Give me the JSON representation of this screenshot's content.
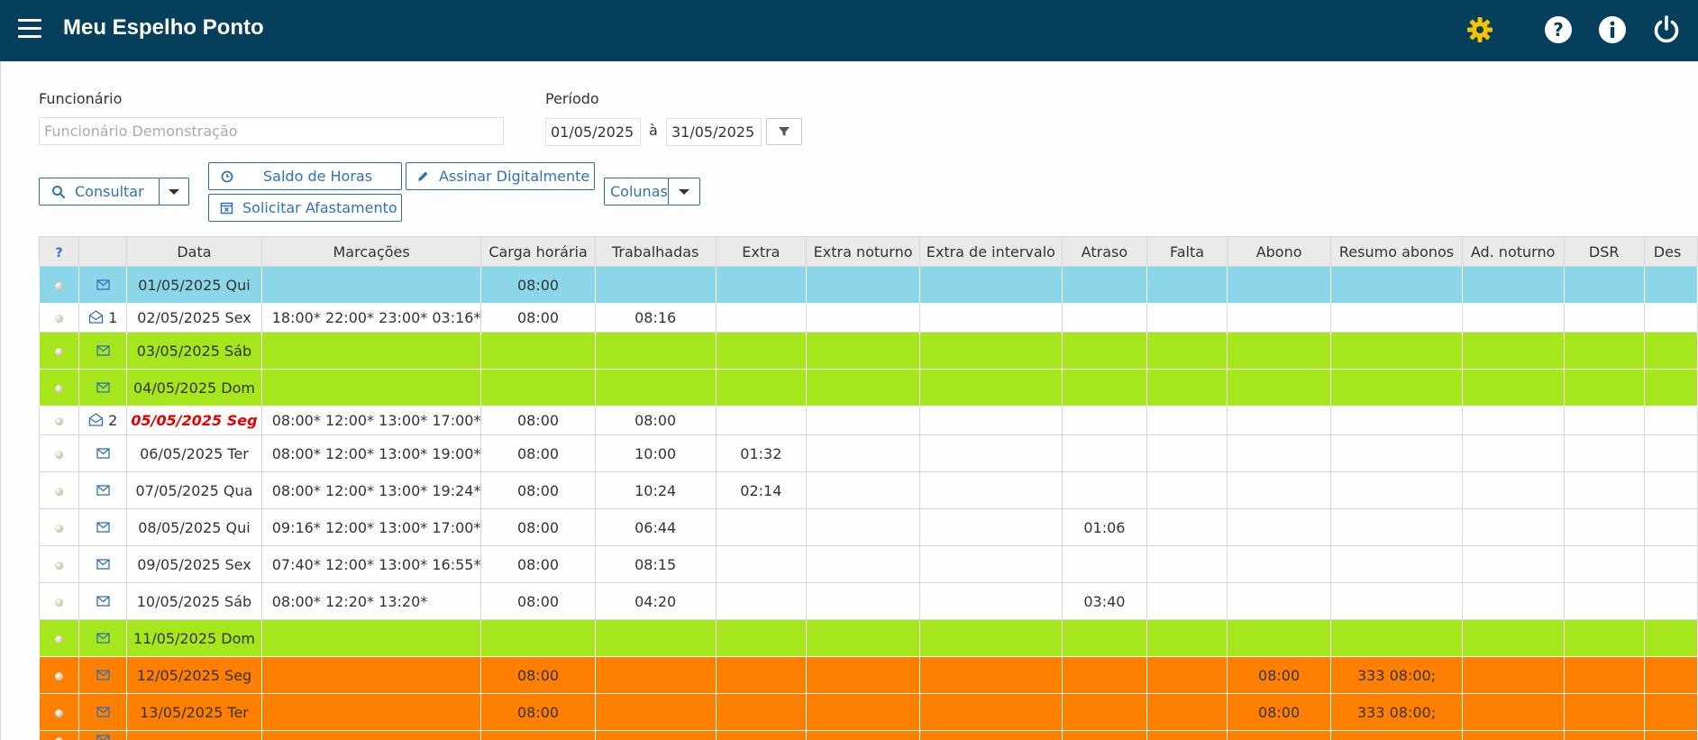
{
  "header": {
    "title": "Meu Espelho Ponto",
    "icons": [
      "menu-icon",
      "gear-icon",
      "help-icon",
      "info-icon",
      "power-icon"
    ],
    "colors": {
      "bar": "#053f5c",
      "gear": "#f5c400",
      "icon": "#ffffff"
    }
  },
  "form": {
    "employee_label": "Funcionário",
    "employee_placeholder": "Funcionário Demonstração",
    "period_label": "Período",
    "date_from": "01/05/2025",
    "date_sep": "à",
    "date_to": "31/05/2025"
  },
  "buttons": {
    "consultar": "Consultar",
    "saldo": "Saldo de Horas",
    "assinar": "Assinar Digitalmente",
    "solicitar": "Solicitar Afastamento",
    "colunas": "Colunas"
  },
  "table": {
    "help_header": "?",
    "columns": [
      "Data",
      "Marcações",
      "Carga horária",
      "Trabalhadas",
      "Extra",
      "Extra noturno",
      "Extra de intervalo",
      "Atraso",
      "Falta",
      "Abono",
      "Resumo abonos",
      "Ad. noturno",
      "DSR",
      "Des"
    ],
    "row_colors": {
      "blue": "#8cd6ea",
      "green": "#a6e61d",
      "orange": "#ff7f00",
      "white": "#ffffff"
    },
    "rows": [
      {
        "type": "blue",
        "icon": "mail-icon",
        "count": "",
        "date": "01/05/2025 Qui",
        "marcacoes": "",
        "carga": "08:00",
        "trabalhadas": "",
        "extra": "",
        "atraso": "",
        "abono": "",
        "resumo": ""
      },
      {
        "type": "white",
        "icon": "mail-open-icon",
        "count": "1",
        "date": "02/05/2025 Sex",
        "marcacoes": "18:00* 22:00* 23:00* 03:16*",
        "carga": "08:00",
        "trabalhadas": "08:16",
        "extra": "",
        "atraso": "",
        "abono": "",
        "resumo": ""
      },
      {
        "type": "green",
        "icon": "mail-icon",
        "count": "",
        "date": "03/05/2025 Sáb",
        "marcacoes": "",
        "carga": "",
        "trabalhadas": "",
        "extra": "",
        "atraso": "",
        "abono": "",
        "resumo": ""
      },
      {
        "type": "green",
        "icon": "mail-icon",
        "count": "",
        "date": "04/05/2025 Dom",
        "marcacoes": "",
        "carga": "",
        "trabalhadas": "",
        "extra": "",
        "atraso": "",
        "abono": "",
        "resumo": ""
      },
      {
        "type": "white",
        "icon": "mail-open-icon",
        "count": "2",
        "date": "05/05/2025 Seg",
        "date_red": true,
        "marcacoes": "08:00* 12:00* 13:00* 17:00*",
        "carga": "08:00",
        "trabalhadas": "08:00",
        "extra": "",
        "atraso": "",
        "abono": "",
        "resumo": ""
      },
      {
        "type": "white",
        "icon": "mail-icon",
        "count": "",
        "date": "06/05/2025 Ter",
        "marcacoes": "08:00* 12:00* 13:00* 19:00*",
        "carga": "08:00",
        "trabalhadas": "10:00",
        "extra": "01:32",
        "atraso": "",
        "abono": "",
        "resumo": ""
      },
      {
        "type": "white",
        "icon": "mail-icon",
        "count": "",
        "date": "07/05/2025 Qua",
        "marcacoes": "08:00* 12:00* 13:00* 19:24*",
        "carga": "08:00",
        "trabalhadas": "10:24",
        "extra": "02:14",
        "atraso": "",
        "abono": "",
        "resumo": ""
      },
      {
        "type": "white",
        "icon": "mail-icon",
        "count": "",
        "date": "08/05/2025 Qui",
        "marcacoes": "09:16* 12:00* 13:00* 17:00*",
        "carga": "08:00",
        "trabalhadas": "06:44",
        "extra": "",
        "atraso": "01:06",
        "abono": "",
        "resumo": ""
      },
      {
        "type": "white",
        "icon": "mail-icon",
        "count": "",
        "date": "09/05/2025 Sex",
        "marcacoes": "07:40* 12:00* 13:00* 16:55*",
        "carga": "08:00",
        "trabalhadas": "08:15",
        "extra": "",
        "atraso": "",
        "abono": "",
        "resumo": ""
      },
      {
        "type": "white",
        "icon": "mail-icon",
        "count": "",
        "date": "10/05/2025 Sáb",
        "marcacoes": "08:00* 12:20* 13:20*",
        "carga": "08:00",
        "trabalhadas": "04:20",
        "extra": "",
        "atraso": "03:40",
        "abono": "",
        "resumo": ""
      },
      {
        "type": "green",
        "icon": "mail-icon",
        "count": "",
        "date": "11/05/2025 Dom",
        "marcacoes": "",
        "carga": "",
        "trabalhadas": "",
        "extra": "",
        "atraso": "",
        "abono": "",
        "resumo": ""
      },
      {
        "type": "orange",
        "icon": "mail-icon",
        "count": "",
        "date": "12/05/2025 Seg",
        "marcacoes": "",
        "carga": "08:00",
        "trabalhadas": "",
        "extra": "",
        "atraso": "",
        "abono": "08:00",
        "resumo": "333 08:00;"
      },
      {
        "type": "orange",
        "icon": "mail-icon",
        "count": "",
        "date": "13/05/2025 Ter",
        "marcacoes": "",
        "carga": "08:00",
        "trabalhadas": "",
        "extra": "",
        "atraso": "",
        "abono": "08:00",
        "resumo": "333 08:00;"
      },
      {
        "type": "orange",
        "icon": "mail-icon",
        "count": "",
        "date": "",
        "marcacoes": "",
        "carga": "",
        "trabalhadas": "",
        "extra": "",
        "atraso": "",
        "abono": "",
        "resumo": ""
      }
    ]
  }
}
